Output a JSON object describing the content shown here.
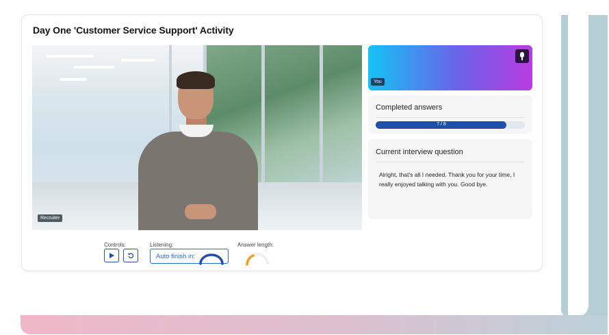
{
  "page": {
    "title": "Day One 'Customer Service Support' Activity"
  },
  "video": {
    "recruiter_tag": "Recruiter"
  },
  "self_view": {
    "you_tag": "You",
    "mic_icon": "microphone-icon"
  },
  "completed_answers": {
    "heading": "Completed answers",
    "progress_text": "7 / 8",
    "completed": 7,
    "total": 8
  },
  "current_question": {
    "heading": "Current interview question",
    "text": "Alright, that's all I needed. Thank you for your time, I really enjoyed talking with you. Good bye."
  },
  "controls": {
    "controls_label": "Controls:",
    "play_icon": "play-icon",
    "replay_icon": "replay-icon",
    "listening_label": "Listening:",
    "auto_finish_label": "Auto finish in:",
    "answer_length_label": "Answer length:"
  },
  "colors": {
    "accent": "#1f4fa6",
    "listening_accent": "#1f6fd0",
    "answer_length_arc": "#f0a020",
    "you_gradient_start": "#15c2f4",
    "you_gradient_end": "#b93be0"
  }
}
